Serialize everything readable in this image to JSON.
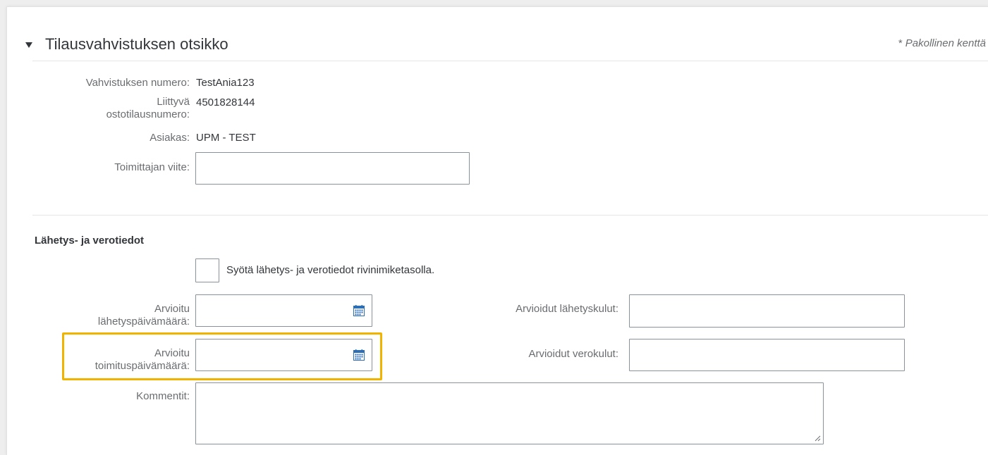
{
  "header": {
    "title": "Tilausvahvistuksen otsikko",
    "required_star": "*",
    "required_note": "Pakollinen kenttä"
  },
  "confirmation": {
    "number_label": "Vahvistuksen numero:",
    "number_value": "TestAnia123",
    "po_label_line1": "Liittyvä",
    "po_label_line2": "ostotilausnumero:",
    "po_value": "4501828144",
    "customer_label": "Asiakas:",
    "customer_value": "UPM - TEST",
    "supplier_ref_label": "Toimittajan viite:",
    "supplier_ref_value": ""
  },
  "shipping": {
    "heading": "Lähetys- ja verotiedot",
    "line_level_checkbox_label": "Syötä lähetys- ja verotiedot rivinimiketasolla.",
    "ship_date_label_line1": "Arvioitu",
    "ship_date_label_line2": "lähetyspäivämäärä:",
    "ship_date_value": "",
    "delivery_date_label_line1": "Arvioitu",
    "delivery_date_label_line2": "toimituspäivämäärä:",
    "delivery_date_value": "",
    "shipping_cost_label": "Arvioidut lähetyskulut:",
    "shipping_cost_value": "",
    "tax_cost_label": "Arvioidut verokulut:",
    "tax_cost_value": "",
    "comments_label": "Kommentit:",
    "comments_value": ""
  },
  "icons": {
    "collapse": "triangle-down-icon",
    "calendar": "calendar-icon",
    "resize": "resize-grip-icon"
  },
  "colors": {
    "highlight": "#f0b400",
    "calendar_blue": "#2c6fb7"
  }
}
